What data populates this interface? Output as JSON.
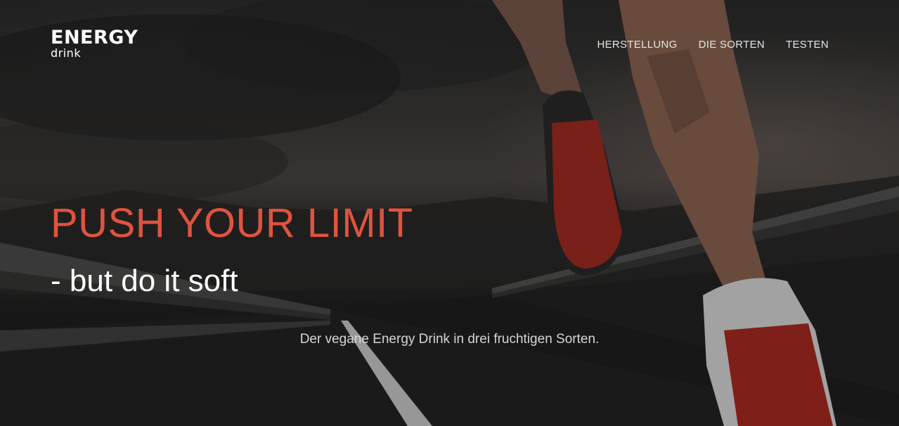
{
  "logo": {
    "line1": "ENERGY",
    "line2": "drink"
  },
  "nav": {
    "items": [
      {
        "label": "HERSTELLUNG"
      },
      {
        "label": "DIE SORTEN"
      },
      {
        "label": "TESTEN"
      }
    ]
  },
  "hero": {
    "headline": "PUSH YOUR LIMIT",
    "subline": "- but do it soft",
    "tagline": "Der vegane Energy Drink in drei fruchtigen Sorten."
  },
  "colors": {
    "accent": "#e0533f",
    "text_light": "#ffffff",
    "nav_text": "#e6e6e6"
  }
}
